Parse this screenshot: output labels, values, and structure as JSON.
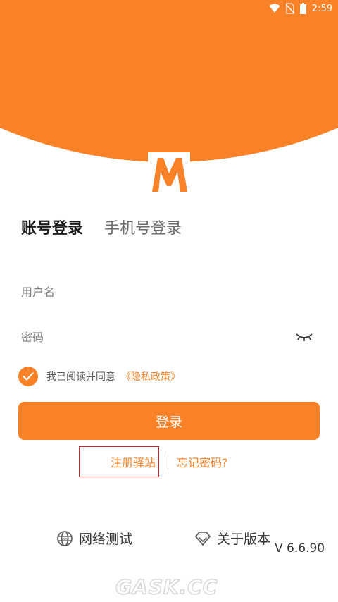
{
  "status_bar": {
    "time": "2:59",
    "icons": [
      "wifi-icon",
      "no-sim-icon",
      "battery-icon"
    ]
  },
  "brand": {
    "accent_color": "#f98128",
    "logo_letter": "M"
  },
  "tabs": {
    "active": "账号登录",
    "inactive": "手机号登录"
  },
  "form": {
    "username_placeholder": "用户名",
    "password_placeholder": "密码",
    "agree_text": "我已阅读并同意",
    "privacy_link": "《隐私政策》",
    "agree_checked": true,
    "login_label": "登录"
  },
  "links": {
    "register": "注册驿站",
    "forgot": "忘记密码?"
  },
  "bottom": {
    "network_test": "网络测试",
    "about_version": "关于版本",
    "version": "V 6.6.90"
  },
  "watermark": "GASK.CC"
}
